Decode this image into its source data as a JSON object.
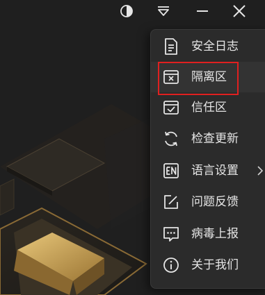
{
  "window": {
    "controls": {
      "theme_icon": "half-circle-icon",
      "dropdown_icon": "menu-dropdown-icon",
      "minimize_icon": "minimize-icon",
      "close_icon": "close-icon"
    }
  },
  "menu": {
    "items": [
      {
        "label": "安全日志",
        "icon": "document-icon"
      },
      {
        "label": "隔离区",
        "icon": "quarantine-icon",
        "highlighted": true
      },
      {
        "label": "信任区",
        "icon": "trust-check-icon"
      },
      {
        "label": "检查更新",
        "icon": "refresh-icon"
      },
      {
        "label": "语言设置",
        "icon": "language-en-icon",
        "has_submenu": true
      },
      {
        "label": "问题反馈",
        "icon": "feedback-edit-icon"
      },
      {
        "label": "病毒上报",
        "icon": "chat-report-icon"
      },
      {
        "label": "关于我们",
        "icon": "info-icon"
      }
    ]
  },
  "colors": {
    "background": "#1f1f1f",
    "menu_background": "#2b2b2b",
    "text": "#e6e6e6",
    "highlight_border": "#e02020",
    "gold_accent": "#b8923f"
  }
}
